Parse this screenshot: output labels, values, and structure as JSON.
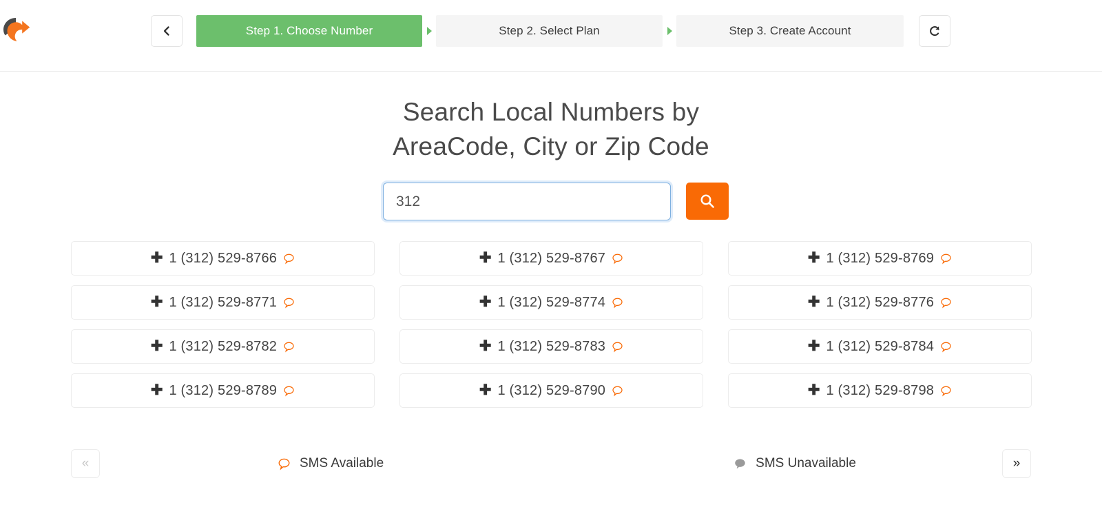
{
  "brand": {
    "logo_icon": "circular-refresh-logo",
    "accent_orange": "#f96a05",
    "accent_green": "#6cbf6c"
  },
  "header": {
    "back_button": {
      "icon": "chevron-left-icon",
      "label": ""
    },
    "reset_button": {
      "icon": "refresh-ccw-icon",
      "label": ""
    },
    "steps": [
      {
        "label": "Step 1. Choose Number",
        "active": true
      },
      {
        "label": "Step 2. Select Plan",
        "active": false
      },
      {
        "label": "Step 3. Create Account",
        "active": false
      }
    ],
    "step_separator_icon": "caret-right-icon"
  },
  "main": {
    "title_line1": "Search Local Numbers by",
    "title_line2": "AreaCode, City or Zip Code",
    "search": {
      "value": "312",
      "placeholder": "",
      "button_icon": "search-icon"
    },
    "numbers": [
      {
        "number": "1 (312) 529-8766",
        "sms": "available"
      },
      {
        "number": "1 (312) 529-8767",
        "sms": "available"
      },
      {
        "number": "1 (312) 529-8769",
        "sms": "available"
      },
      {
        "number": "1 (312) 529-8771",
        "sms": "available"
      },
      {
        "number": "1 (312) 529-8774",
        "sms": "available"
      },
      {
        "number": "1 (312) 529-8776",
        "sms": "available"
      },
      {
        "number": "1 (312) 529-8782",
        "sms": "available"
      },
      {
        "number": "1 (312) 529-8783",
        "sms": "available"
      },
      {
        "number": "1 (312) 529-8784",
        "sms": "available"
      },
      {
        "number": "1 (312) 529-8789",
        "sms": "available"
      },
      {
        "number": "1 (312) 529-8790",
        "sms": "available"
      },
      {
        "number": "1 (312) 529-8798",
        "sms": "available"
      }
    ],
    "add_icon": "plus-icon"
  },
  "footer": {
    "prev_label": "«",
    "next_label": "»",
    "legend": [
      {
        "label": "SMS Available",
        "icon": "speech-bubble-outline-icon",
        "color": "#f96a05"
      },
      {
        "label": "SMS Unavailable",
        "icon": "speech-bubble-filled-icon",
        "color": "#9a9a9a"
      }
    ]
  }
}
